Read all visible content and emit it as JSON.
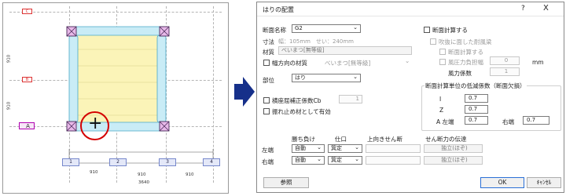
{
  "plan": {
    "row_tags": [
      "C",
      "B",
      "A"
    ],
    "col_tags": [
      "1",
      "2",
      "3",
      "4"
    ],
    "left_dims": [
      "910",
      "910"
    ],
    "bottom_dims": [
      "910",
      "910",
      "910"
    ],
    "total_dim": "3640",
    "cursor_glyph": "+"
  },
  "colors": {
    "accent": "#2a6fd6",
    "beam_fill": "#fbf4b8",
    "column_fill": "#c9ecf6",
    "cursor_circle": "#d40000",
    "arrow": "#16308a"
  },
  "dialog": {
    "title": "はりの配置",
    "help_label": "?",
    "close_label": "X",
    "section_name_label": "断面名称",
    "section_name_value": "G2",
    "dimension_label": "寸法",
    "dimension_value": "幅：105mm　せい：240mm",
    "material_label": "材質",
    "material_value": "べいまつ[無等級]",
    "width_material_label": "幅方向の材質",
    "width_material_value": "べいまつ[無等級]",
    "member_label": "部位",
    "member_value": "はり",
    "buckling_label": "横座屈補正係数Cb",
    "buckling_value": "1",
    "stopper_label": "振れ止め材として有効",
    "section_calc_label": "断面計算する",
    "wind_beam_label": "吹抜に面した耐風梁",
    "wind_calc_label": "断面計算する",
    "wind_width_label": "風圧力負担幅",
    "wind_width_value": "0",
    "wind_width_unit": "mm",
    "wind_coef_label": "風力係数",
    "wind_coef_value": "1",
    "reduction_group_label": "断面計算単位の低減係数（断面欠損）",
    "i_label": "I",
    "i_value": "0.7",
    "z_label": "Z",
    "z_value": "0.7",
    "a_left_label": "A 左端",
    "a_left_value": "0.7",
    "a_right_label": "右端",
    "a_right_value": "0.7",
    "table_headers": [
      "勝ち負け",
      "仕口",
      "上向きせん断",
      "せん断力の伝達"
    ],
    "rows": [
      {
        "label": "左端",
        "win_lose": "自動",
        "joint": "箕定",
        "shear_up": "",
        "transfer": "独立(ほぞ)"
      },
      {
        "label": "右端",
        "win_lose": "自動",
        "joint": "箕定",
        "shear_up": "",
        "transfer": "独立(ほぞ)"
      }
    ],
    "reference_button": "参照",
    "ok_button": "OK",
    "cancel_button": "ｷｬﾝｾﾙ"
  }
}
